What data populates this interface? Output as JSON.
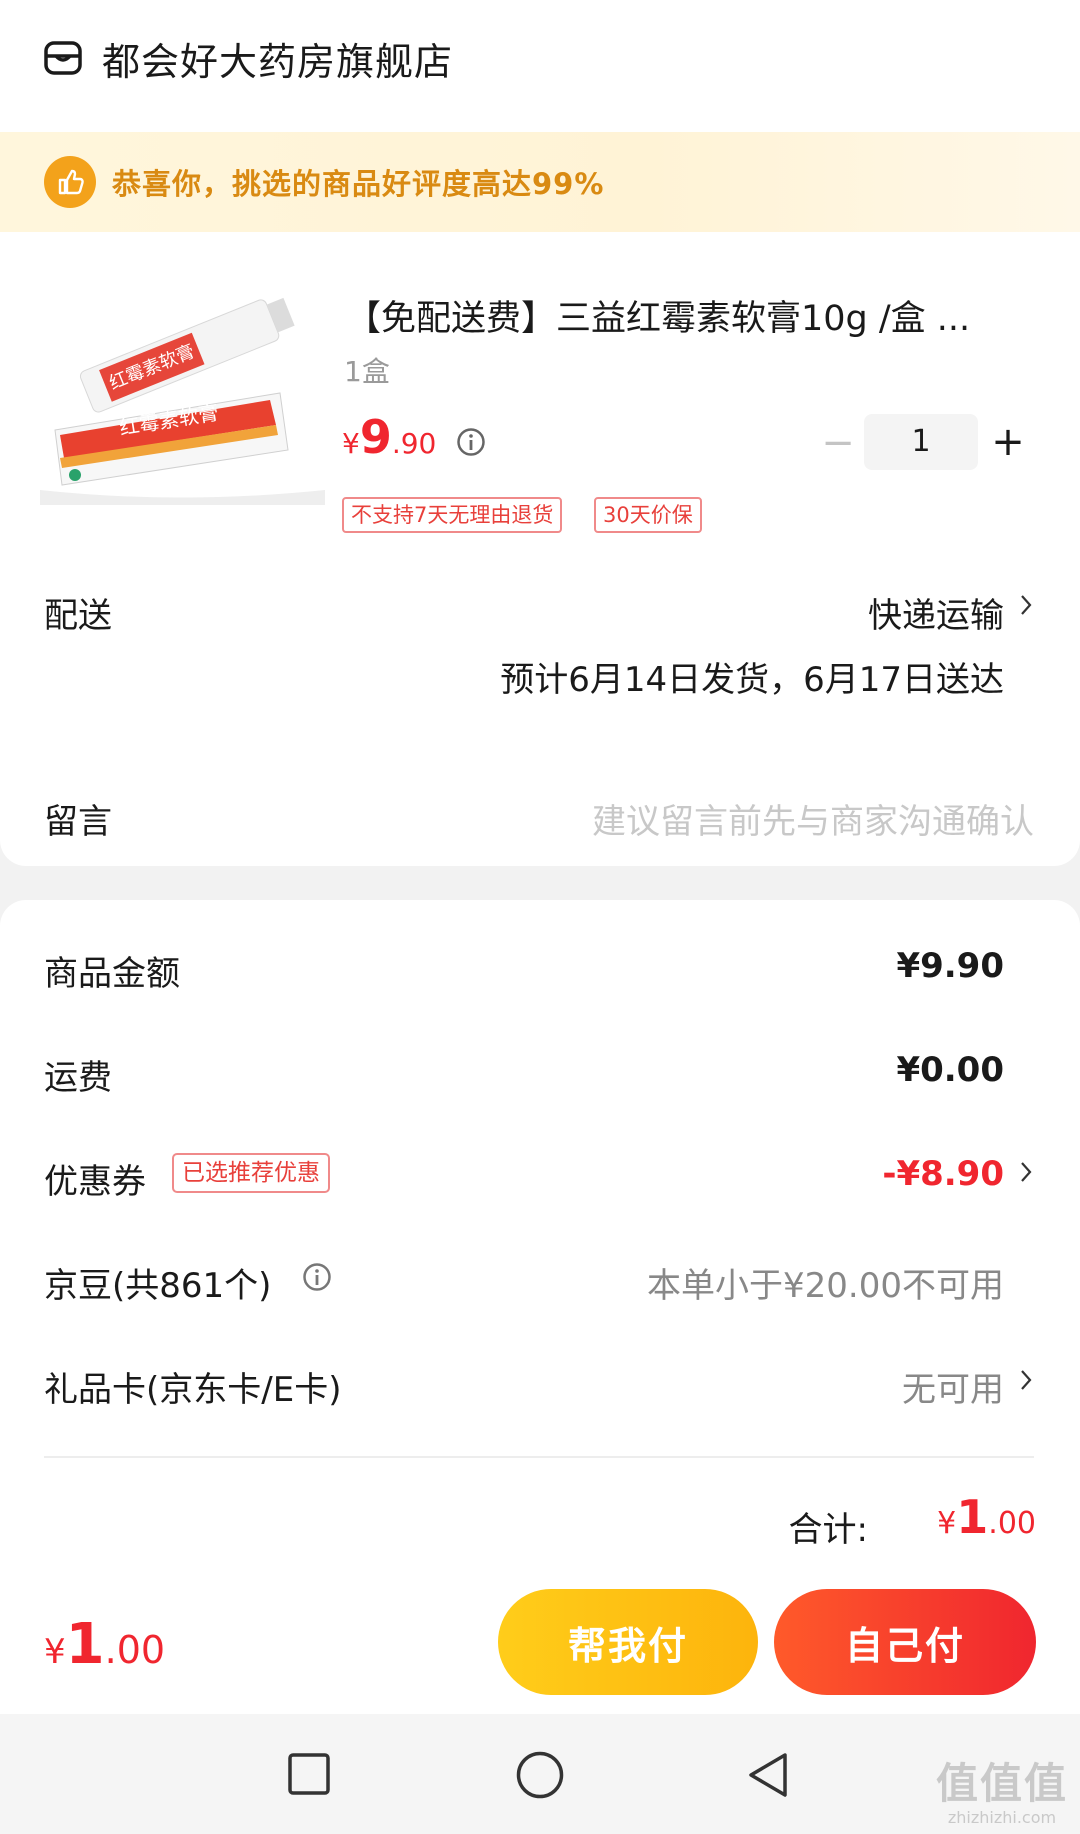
{
  "store": {
    "name": "都会好大药房旗舰店",
    "icon": "store-icon"
  },
  "banner": {
    "text": "恭喜你，挑选的商品好评度高达99%",
    "icon": "thumbs-up-icon",
    "color": "#d98a12"
  },
  "product": {
    "title": "【免配送费】三益红霉素软膏10g /盒 ...",
    "spec": "1盒",
    "price_symbol": "¥",
    "price_int": "9",
    "price_dec": ".90",
    "quantity": "1",
    "minus": "−",
    "plus": "+",
    "tags": [
      "不支持7天无理由退货",
      "30天价保"
    ],
    "image_label": "红霉素软膏"
  },
  "delivery": {
    "label": "配送",
    "method": "快递运输",
    "estimate": "预计6月14日发货，6月17日送达"
  },
  "message": {
    "label": "留言",
    "placeholder": "建议留言前先与商家沟通确认"
  },
  "summary": {
    "goods_label": "商品金额",
    "goods_value": "¥9.90",
    "shipping_label": "运费",
    "shipping_value": "¥0.00",
    "coupon_label": "优惠券",
    "coupon_badge": "已选推荐优惠",
    "coupon_value": "-¥8.90",
    "beans_label": "京豆(共861个)",
    "beans_value": "本单小于¥20.00不可用",
    "giftcard_label": "礼品卡(京东卡/E卡)",
    "giftcard_value": "无可用",
    "total_label": "合计:",
    "total_symbol": "¥",
    "total_int": "1",
    "total_dec": ".00"
  },
  "footer": {
    "pay_symbol": "¥",
    "pay_int": "1",
    "pay_dec": ".00",
    "help_pay_label": "帮我付",
    "self_pay_label": "自己付"
  },
  "navbar": {
    "items": [
      "recent-apps-icon",
      "home-icon",
      "back-icon"
    ]
  },
  "watermark": {
    "main": "值值值",
    "sub": "zhizhizhi.com"
  },
  "colors": {
    "accent_red": "#f0262f",
    "accent_yellow": "#ffcd1a"
  }
}
